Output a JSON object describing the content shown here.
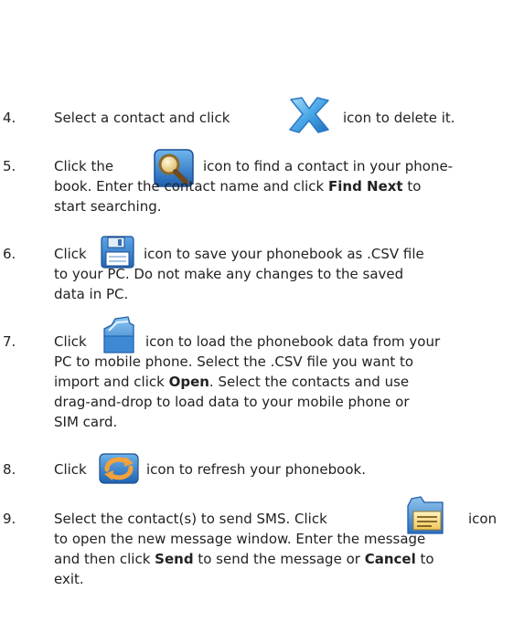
{
  "steps": [
    {
      "number": "4.",
      "lines": [
        {
          "before": "Select a contact and click",
          "after": "icon to delete it."
        }
      ],
      "icon": "delete-x-icon"
    },
    {
      "number": "5.",
      "lines": [
        {
          "before": "Click the",
          "after": "icon to find a contact in your phone-"
        },
        {
          "text": "book. Enter the contact name and click ",
          "bold": "Find Next",
          "after": " to"
        },
        {
          "text": "start searching."
        }
      ],
      "icon": "search-magnifier-icon"
    },
    {
      "number": "6.",
      "lines": [
        {
          "before": "Click",
          "after": "icon to save your phonebook as .CSV file"
        },
        {
          "text": "to your PC. Do not make any changes to the saved"
        },
        {
          "text": "data in PC."
        }
      ],
      "icon": "save-floppy-icon"
    },
    {
      "number": "7.",
      "lines": [
        {
          "before": "Click",
          "after": "icon to load the phonebook data from your"
        },
        {
          "text": "PC to mobile phone. Select the .CSV file you want to"
        },
        {
          "text": "import and click ",
          "bold": "Open",
          "after": ". Select the contacts and use"
        },
        {
          "text": "drag-and-drop to load data to your mobile phone or"
        },
        {
          "text": "SIM card."
        }
      ],
      "icon": "open-folder-icon"
    },
    {
      "number": "8.",
      "lines": [
        {
          "before": "Click",
          "after": "icon to refresh your phonebook."
        }
      ],
      "icon": "refresh-arrows-icon"
    },
    {
      "number": "9.",
      "lines": [
        {
          "before": "Select the contact(s) to send SMS. Click",
          "after": "icon"
        },
        {
          "text": "to open the new message window. Enter the message"
        },
        {
          "text": "and then click ",
          "bold": "Send",
          "mid": " to send the message or ",
          "bold2": "Cancel",
          "after": " to"
        },
        {
          "text": "exit."
        }
      ],
      "icon": "message-folder-icon"
    }
  ]
}
